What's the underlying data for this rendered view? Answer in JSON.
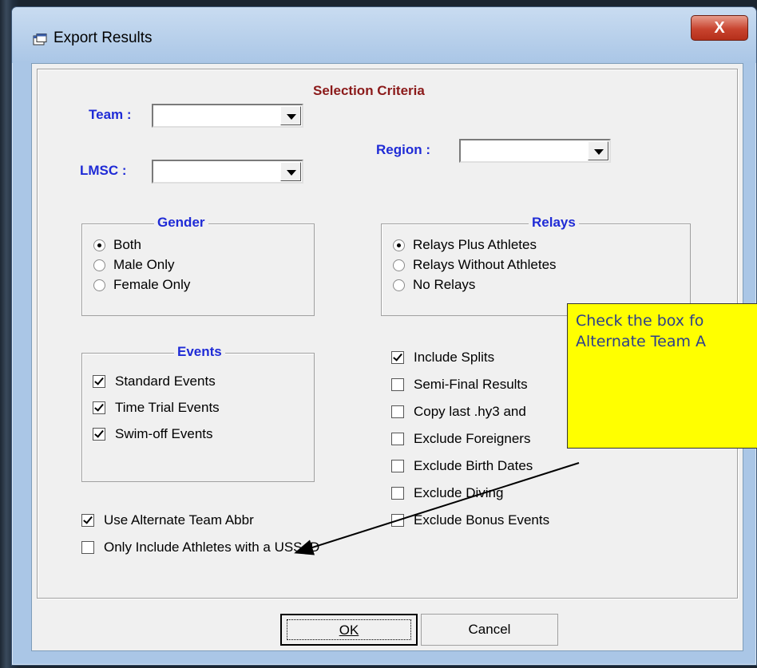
{
  "window": {
    "title": "Export Results",
    "close_label": "X"
  },
  "selection": {
    "title": "Selection Criteria",
    "team_label": "Team :",
    "lmsc_label": "LMSC :",
    "region_label": "Region :",
    "team_value": "",
    "lmsc_value": "",
    "region_value": ""
  },
  "gender": {
    "title": "Gender",
    "options": [
      {
        "label": "Both",
        "selected": true
      },
      {
        "label": "Male Only",
        "selected": false
      },
      {
        "label": "Female Only",
        "selected": false
      }
    ]
  },
  "relays": {
    "title": "Relays",
    "options": [
      {
        "label": "Relays Plus Athletes",
        "selected": true
      },
      {
        "label": "Relays Without Athletes",
        "selected": false
      },
      {
        "label": "No Relays",
        "selected": false
      }
    ]
  },
  "events": {
    "title": "Events",
    "options": [
      {
        "label": "Standard Events",
        "checked": true
      },
      {
        "label": "Time Trial Events",
        "checked": true
      },
      {
        "label": "Swim-off Events",
        "checked": true
      }
    ]
  },
  "right_options": [
    {
      "label": "Include Splits",
      "checked": true
    },
    {
      "label": "Semi-Final Results",
      "checked": false
    },
    {
      "label": "Copy last .hy3 and",
      "checked": false
    },
    {
      "label": "Exclude Foreigners",
      "checked": false
    },
    {
      "label": "Exclude Birth Dates",
      "checked": false
    },
    {
      "label": "Exclude Diving",
      "checked": false
    },
    {
      "label": "Exclude Bonus Events",
      "checked": false
    }
  ],
  "bottom_options": [
    {
      "label": "Use Alternate Team Abbr",
      "checked": true
    },
    {
      "label": "Only Include Athletes with a USS ID",
      "checked": false
    }
  ],
  "buttons": {
    "ok": "OK",
    "cancel": "Cancel"
  },
  "callout": {
    "line1": "Check the box fo",
    "line2": "Alternate Team A"
  },
  "colors": {
    "section_title": "#8b1a1a",
    "label_blue": "#1f2bd6",
    "callout_bg": "#ffff00"
  }
}
